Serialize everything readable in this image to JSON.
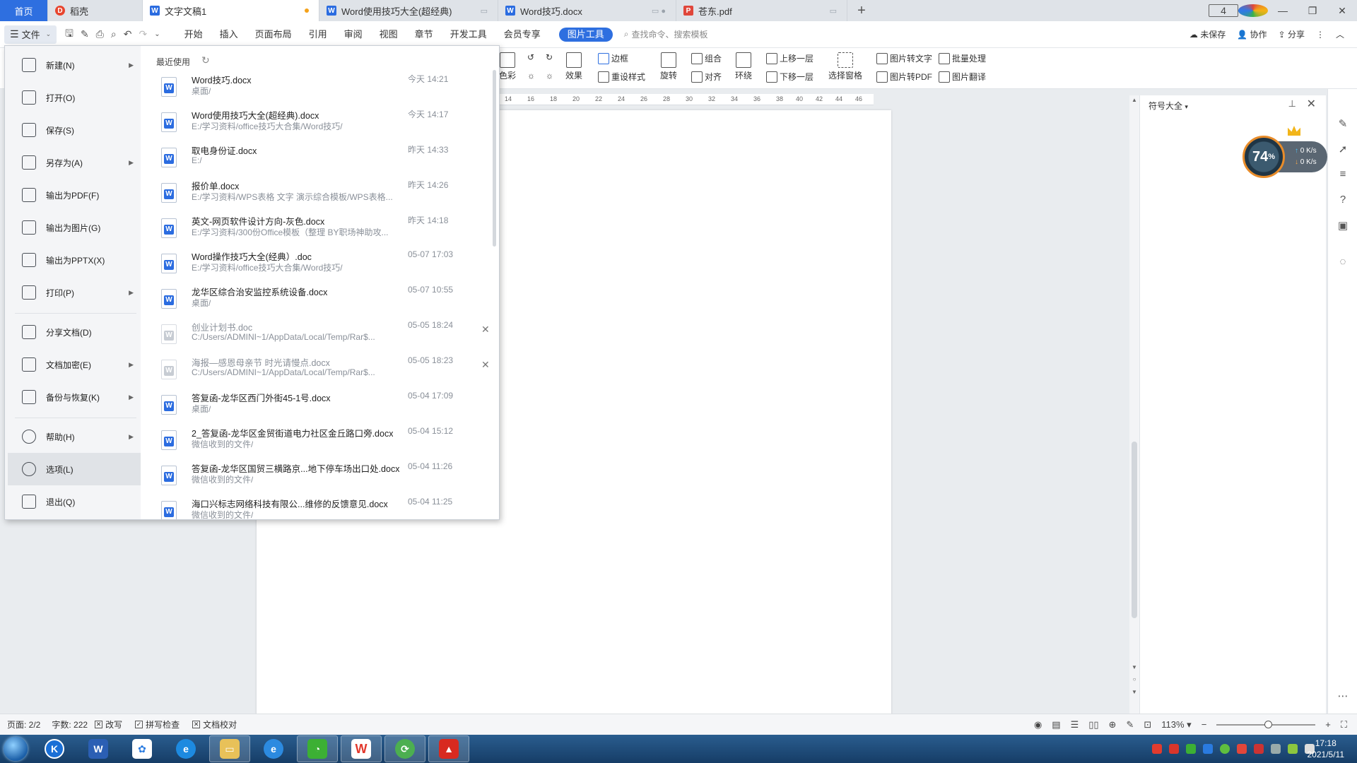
{
  "tabs": {
    "home": "首页",
    "items": [
      {
        "label": "稻壳"
      },
      {
        "label": "文字文稿1"
      },
      {
        "label": "Word使用技巧大全(超经典)"
      },
      {
        "label": "Word技巧.docx"
      },
      {
        "label": "苍东.pdf"
      }
    ],
    "add": "+",
    "window_badge": "4"
  },
  "menubar": {
    "file": "文件",
    "items": [
      "开始",
      "插入",
      "页面布局",
      "引用",
      "审阅",
      "视图",
      "章节",
      "开发工具",
      "会员专享"
    ],
    "active_contextual": "图片工具",
    "search_placeholder": "查找命令、搜索模板",
    "unsaved": "未保存",
    "collab": "协作",
    "share": "分享"
  },
  "ribbon": {
    "border": "边框",
    "color": "色彩",
    "effect": "效果",
    "reset_style": "重设样式",
    "rotate": "旋转",
    "group": "组合",
    "align": "对齐",
    "wrap": "环绕",
    "bring_forward": "上移一层",
    "send_backward": "下移一层",
    "selection_pane": "选择窗格",
    "pic_to_text": "图片转文字",
    "batch": "批量处理",
    "pic_to_pdf": "图片转PDF",
    "pic_translate": "图片翻译"
  },
  "ruler": [
    "14",
    "16",
    "18",
    "20",
    "22",
    "24",
    "26",
    "28",
    "30",
    "32",
    "34",
    "36",
    "38",
    "40",
    "42",
    "44",
    "46"
  ],
  "file_menu": {
    "items": [
      {
        "label": "新建(N)",
        "icon": "new-doc-icon",
        "submenu": true
      },
      {
        "label": "打开(O)",
        "icon": "folder-open-icon",
        "submenu": false
      },
      {
        "label": "保存(S)",
        "icon": "save-icon",
        "submenu": false
      },
      {
        "label": "另存为(A)",
        "icon": "save-as-icon",
        "submenu": true
      },
      {
        "label": "输出为PDF(F)",
        "icon": "export-pdf-icon",
        "submenu": false
      },
      {
        "label": "输出为图片(G)",
        "icon": "export-image-icon",
        "submenu": false
      },
      {
        "label": "输出为PPTX(X)",
        "icon": "export-pptx-icon",
        "submenu": false
      },
      {
        "label": "打印(P)",
        "icon": "print-icon",
        "submenu": true
      },
      {
        "label": "分享文档(D)",
        "icon": "share-doc-icon",
        "submenu": false
      },
      {
        "label": "文档加密(E)",
        "icon": "encrypt-icon",
        "submenu": true
      },
      {
        "label": "备份与恢复(K)",
        "icon": "backup-icon",
        "submenu": true
      },
      {
        "label": "帮助(H)",
        "icon": "help-icon",
        "submenu": true
      },
      {
        "label": "选项(L)",
        "icon": "options-gear-icon",
        "submenu": false
      },
      {
        "label": "退出(Q)",
        "icon": "exit-icon",
        "submenu": false
      }
    ],
    "recent_title": "最近使用",
    "recent": [
      {
        "name": "Word技巧.docx",
        "path": "桌面/",
        "time": "今天 14:21",
        "faded": false
      },
      {
        "name": "Word使用技巧大全(超经典).docx",
        "path": "E:/学习资料/office技巧大合集/Word技巧/",
        "time": "今天 14:17",
        "faded": false
      },
      {
        "name": "取电身份证.docx",
        "path": "E:/",
        "time": "昨天 14:33",
        "faded": false
      },
      {
        "name": "报价单.docx",
        "path": "E:/学习资料/WPS表格 文字 演示综合模板/WPS表格...",
        "time": "昨天 14:26",
        "faded": false
      },
      {
        "name": "英文-网页软件设计方向-灰色.docx",
        "path": "E:/学习资料/300份Office模板（整理 BY职场神助攻...",
        "time": "昨天 14:18",
        "faded": false
      },
      {
        "name": "Word操作技巧大全(经典）.doc",
        "path": "E:/学习资料/office技巧大合集/Word技巧/",
        "time": "05-07 17:03",
        "faded": false
      },
      {
        "name": "龙华区综合治安监控系统设备.docx",
        "path": "桌面/",
        "time": "05-07 10:55",
        "faded": false
      },
      {
        "name": "创业计划书.doc",
        "path": "C:/Users/ADMINI~1/AppData/Local/Temp/Rar$...",
        "time": "05-05 18:24",
        "faded": true
      },
      {
        "name": "海报—感恩母亲节 时光请慢点.docx",
        "path": "C:/Users/ADMINI~1/AppData/Local/Temp/Rar$...",
        "time": "05-05 18:23",
        "faded": true
      },
      {
        "name": "答复函-龙华区西门外街45-1号.docx",
        "path": "桌面/",
        "time": "05-04 17:09",
        "faded": false
      },
      {
        "name": "2_答复函-龙华区金贸街道电力社区金丘路口旁.docx",
        "path": "微信收到的文件/",
        "time": "05-04 15:12",
        "faded": false
      },
      {
        "name": "答复函-龙华区国贸三横路京...地下停车场出口处.docx",
        "path": "微信收到的文件/",
        "time": "05-04 11:26",
        "faded": false
      },
      {
        "name": "海口兴标志网络科技有限公...维修的反馈意见.docx",
        "path": "微信收到的文件/",
        "time": "05-04 11:25",
        "faded": false
      }
    ]
  },
  "right_panel": {
    "title": "符号大全"
  },
  "speed_widget": {
    "percent": "74",
    "unit": "%",
    "up": "0 K/s",
    "down": "0 K/s"
  },
  "status": {
    "page": "页面: 2/2",
    "words": "字数: 222",
    "revise": "改写",
    "spell": "拼写检查",
    "proof": "文档校对",
    "zoom": "113%"
  },
  "clock": {
    "time": "17:18",
    "date": "2021/5/11"
  },
  "colors": {
    "accent": "#2e6fe0",
    "word_blue": "#2b6ce0",
    "wps_red": "#e8452e"
  }
}
